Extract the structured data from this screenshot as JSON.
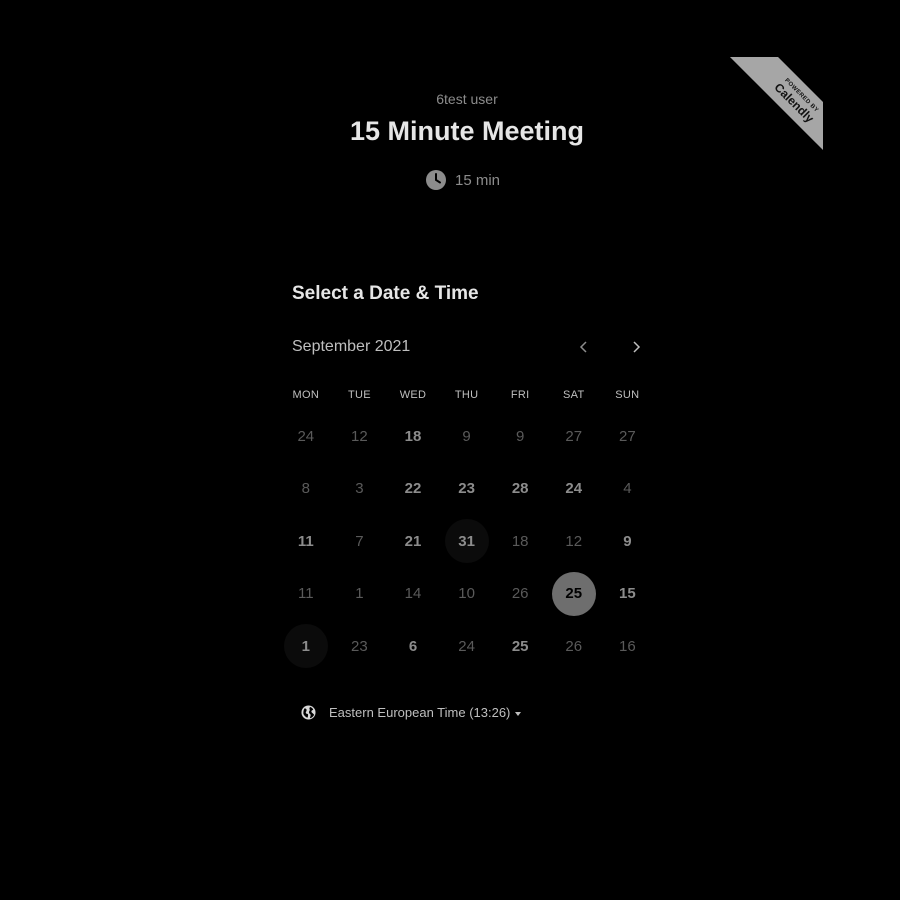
{
  "badge": {
    "line1": "POWERED BY",
    "line2": "Calendly"
  },
  "event": {
    "host": "6test user",
    "title": "15 Minute Meeting",
    "duration": "15 min"
  },
  "picker": {
    "heading": "Select a Date & Time",
    "month": "September 2021",
    "weekdays": [
      "MON",
      "TUE",
      "WED",
      "THU",
      "FRI",
      "SAT",
      "SUN"
    ],
    "weeks": [
      [
        {
          "d": "24"
        },
        {
          "d": "12"
        },
        {
          "d": "18",
          "on": true
        },
        {
          "d": "9"
        },
        {
          "d": "9"
        },
        {
          "d": "27"
        },
        {
          "d": "27"
        }
      ],
      [
        {
          "d": "8"
        },
        {
          "d": "3"
        },
        {
          "d": "22",
          "on": true
        },
        {
          "d": "23",
          "on": true
        },
        {
          "d": "28",
          "on": true
        },
        {
          "d": "24",
          "on": true
        },
        {
          "d": "4"
        }
      ],
      [
        {
          "d": "11",
          "on": true
        },
        {
          "d": "7"
        },
        {
          "d": "21",
          "on": true
        },
        {
          "d": "31",
          "on": true,
          "dot": true
        },
        {
          "d": "18"
        },
        {
          "d": "12"
        },
        {
          "d": "9",
          "on": true
        }
      ],
      [
        {
          "d": "11"
        },
        {
          "d": "1"
        },
        {
          "d": "14"
        },
        {
          "d": "10"
        },
        {
          "d": "26"
        },
        {
          "d": "25",
          "on": true,
          "sel": true
        },
        {
          "d": "15",
          "on": true
        }
      ],
      [
        {
          "d": "1",
          "on": true,
          "dot": true
        },
        {
          "d": "23"
        },
        {
          "d": "6",
          "on": true
        },
        {
          "d": "24"
        },
        {
          "d": "25",
          "on": true
        },
        {
          "d": "26"
        },
        {
          "d": "16"
        }
      ]
    ]
  },
  "timezone": {
    "label": "Eastern European Time (13:26)"
  }
}
